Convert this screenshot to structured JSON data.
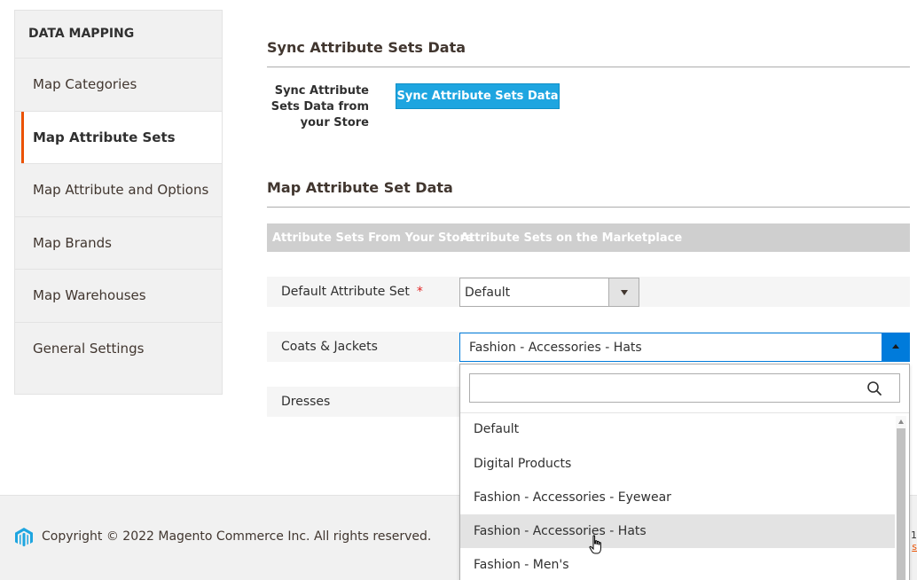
{
  "sidebar": {
    "title": "DATA MAPPING",
    "items": [
      {
        "label": "Map Categories",
        "active": false
      },
      {
        "label": "Map Attribute Sets",
        "active": true
      },
      {
        "label": "Map Attribute and Options",
        "active": false
      },
      {
        "label": "Map Brands",
        "active": false
      },
      {
        "label": "Map Warehouses",
        "active": false
      },
      {
        "label": "General Settings",
        "active": false
      }
    ]
  },
  "sync": {
    "section_title": "Sync Attribute Sets Data",
    "label": "Sync Attribute Sets Data from your Store",
    "button_label": "Sync Attribute Sets Data"
  },
  "mapping": {
    "section_title": "Map Attribute Set Data",
    "col_store": "Attribute Sets From Your Store",
    "col_marketplace": "Attribute Sets on the Marketplace",
    "rows": [
      {
        "label": "Default Attribute Set",
        "required_mark": "*",
        "value": "Default"
      },
      {
        "label": "Coats & Jackets",
        "value": "Fashion - Accessories - Hats"
      },
      {
        "label": "Dresses"
      }
    ]
  },
  "dropdown": {
    "search_value": "",
    "options": [
      "Default",
      "Digital Products",
      "Fashion - Accessories - Eyewear",
      "Fashion - Accessories - Hats",
      "Fashion - Men's"
    ],
    "hovered_option": "Fashion - Accessories - Hats"
  },
  "footer": {
    "copyright": "Copyright © 2022 Magento Commerce Inc. All rights reserved.",
    "version_fragment": ".1",
    "link_fragment": "s"
  },
  "colors": {
    "accent_orange": "#eb5202",
    "button_blue": "#1ea5e0",
    "focus_blue": "#007bdb"
  }
}
